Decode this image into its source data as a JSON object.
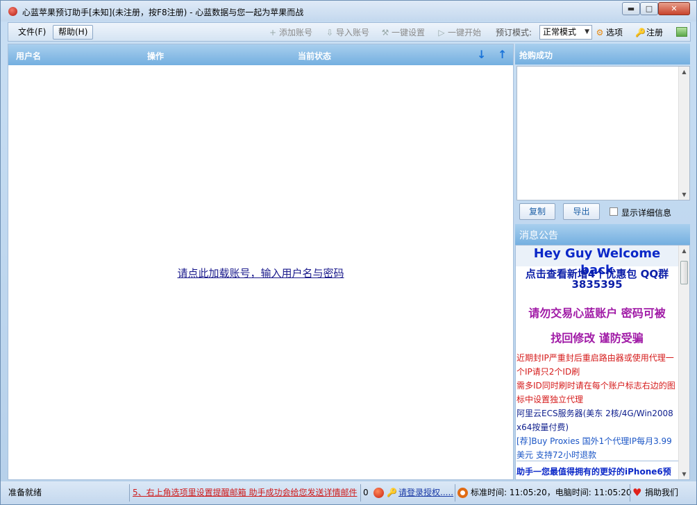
{
  "window": {
    "title": "心蓝苹果预订助手[未知](未注册，按F8注册) - 心蓝数据与您一起为苹果而战",
    "min_glyph": "▬",
    "max_glyph": "□",
    "close_glyph": "✕"
  },
  "menu": {
    "file": "文件(F)",
    "help": "帮助(H)"
  },
  "toolbar": {
    "add_account": "添加账号",
    "import_account": "导入账号",
    "one_key_setup": "一键设置",
    "one_key_start": "一键开始",
    "mode_label": "预订模式:",
    "mode_value": "正常模式",
    "options": "选项",
    "register": "注册"
  },
  "icons": {
    "add": "+",
    "import": "⇩",
    "setup": "⚒",
    "start": "▷",
    "options": "⚙",
    "register": "🔑",
    "sort_down": "↓",
    "sort_up": "↑",
    "select_arrow": "▼",
    "scroll_up": "▲",
    "scroll_down": "▼",
    "heart": "♥",
    "key": "🔑"
  },
  "table": {
    "columns": [
      "用户名",
      "操作",
      "当前状态"
    ],
    "empty_link": "请点此加载账号，输入用户名与密码"
  },
  "success_panel": {
    "title": "抢购成功",
    "copy": "复制",
    "export": "导出",
    "show_details": "显示详细信息"
  },
  "notice": {
    "title": "消息公告",
    "welcome": "Hey Guy Welcome back",
    "qq": "点击查看新增4个优惠包 QQ群3835395",
    "trade_1": "请勿交易心蓝账户 密码可被",
    "trade_2": "找回修改 谨防受骗",
    "red_1": "近期封IP严重封后重启路由器或使用代理一个IP请只2个ID刷",
    "red_2": "需多ID同时刷时请在每个账户标志右边的图标中设置独立代理",
    "blue_1": "阿里云ECS服务器(美东 2核/4G/Win2008 x64按量付费)",
    "blue_2": "[荐]Buy Proxies 国外1个代理IP每月3.99美元 支持72小时退款",
    "footer": "助手一您最值得拥有的更好的iPhone6预"
  },
  "status": {
    "ready": "准备就绪",
    "tip": "5、右上角选项里设置提醒邮箱 助手成功会给您发送详情邮件",
    "count": "0",
    "login": "请登录授权.....",
    "time": "标准时间: 11:05:20，电脑时间: 11:05:20",
    "donate": "捐助我们"
  }
}
